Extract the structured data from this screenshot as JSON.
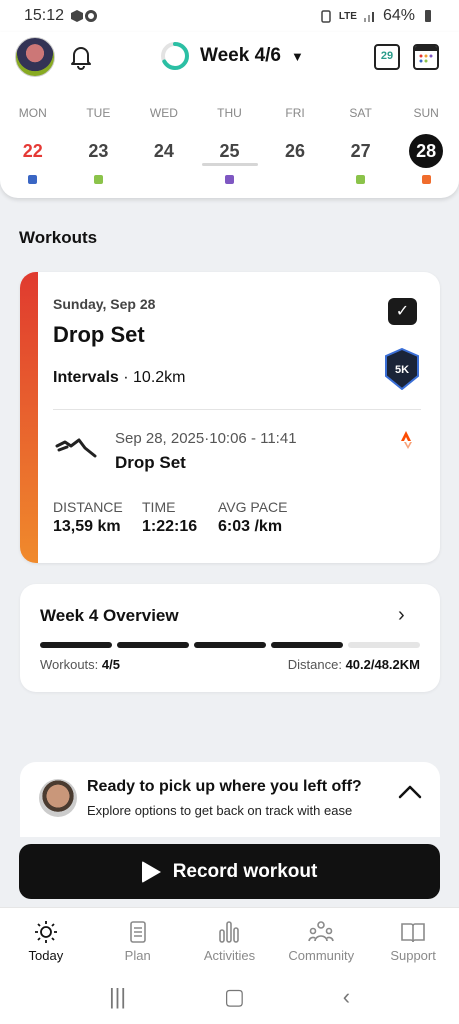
{
  "status_bar": {
    "time": "15:12",
    "network": "LTE",
    "battery": "64%"
  },
  "header": {
    "week_label": "Week 4/6",
    "week_progress": 0.67,
    "today_day_number": "29",
    "days": [
      {
        "name": "MON",
        "num": "22",
        "dot": "#3a66c4",
        "num_color": "#e53935"
      },
      {
        "name": "TUE",
        "num": "23",
        "dot": "#8bc34a",
        "num_color": "#444444"
      },
      {
        "name": "WED",
        "num": "24",
        "dot": "",
        "num_color": "#444444"
      },
      {
        "name": "THU",
        "num": "25",
        "dot": "#7e57c2",
        "num_color": "#444444"
      },
      {
        "name": "FRI",
        "num": "26",
        "dot": "",
        "num_color": "#444444"
      },
      {
        "name": "SAT",
        "num": "27",
        "dot": "#8bc34a",
        "num_color": "#444444"
      },
      {
        "name": "SUN",
        "num": "28",
        "dot": "#f06c2c",
        "num_color": "#ffffff",
        "selected": true
      }
    ]
  },
  "workouts": {
    "section_title": "Workouts",
    "card": {
      "date": "Sunday, Sep 28",
      "title": "Drop Set",
      "type": "Intervals",
      "distance": "10.2km",
      "badge": "5K",
      "activity": {
        "datetime": "Sep 28, 2025·10:06 - 11:41",
        "name": "Drop Set"
      },
      "stats": [
        {
          "label": "DISTANCE",
          "value": "13,59 km"
        },
        {
          "label": "TIME",
          "value": "1:22:16"
        },
        {
          "label": "AVG PACE",
          "value": "6:03 /km"
        }
      ]
    }
  },
  "overview": {
    "title": "Week 4 Overview",
    "progress_segments": [
      1,
      1,
      1,
      1,
      0
    ],
    "workouts_label": "Workouts:",
    "workouts_value": "4/5",
    "distance_label": "Distance:",
    "distance_value": "40.2/48.2KM"
  },
  "resume": {
    "title": "Ready to pick up where you left off?",
    "subtitle": "Explore options to get back on track with ease"
  },
  "record_button": {
    "label": "Record workout"
  },
  "bottom_nav": [
    {
      "label": "Today",
      "icon": "sun-icon",
      "active": true
    },
    {
      "label": "Plan",
      "icon": "clipboard-icon"
    },
    {
      "label": "Activities",
      "icon": "bars-icon"
    },
    {
      "label": "Community",
      "icon": "people-icon"
    },
    {
      "label": "Support",
      "icon": "book-icon"
    }
  ]
}
